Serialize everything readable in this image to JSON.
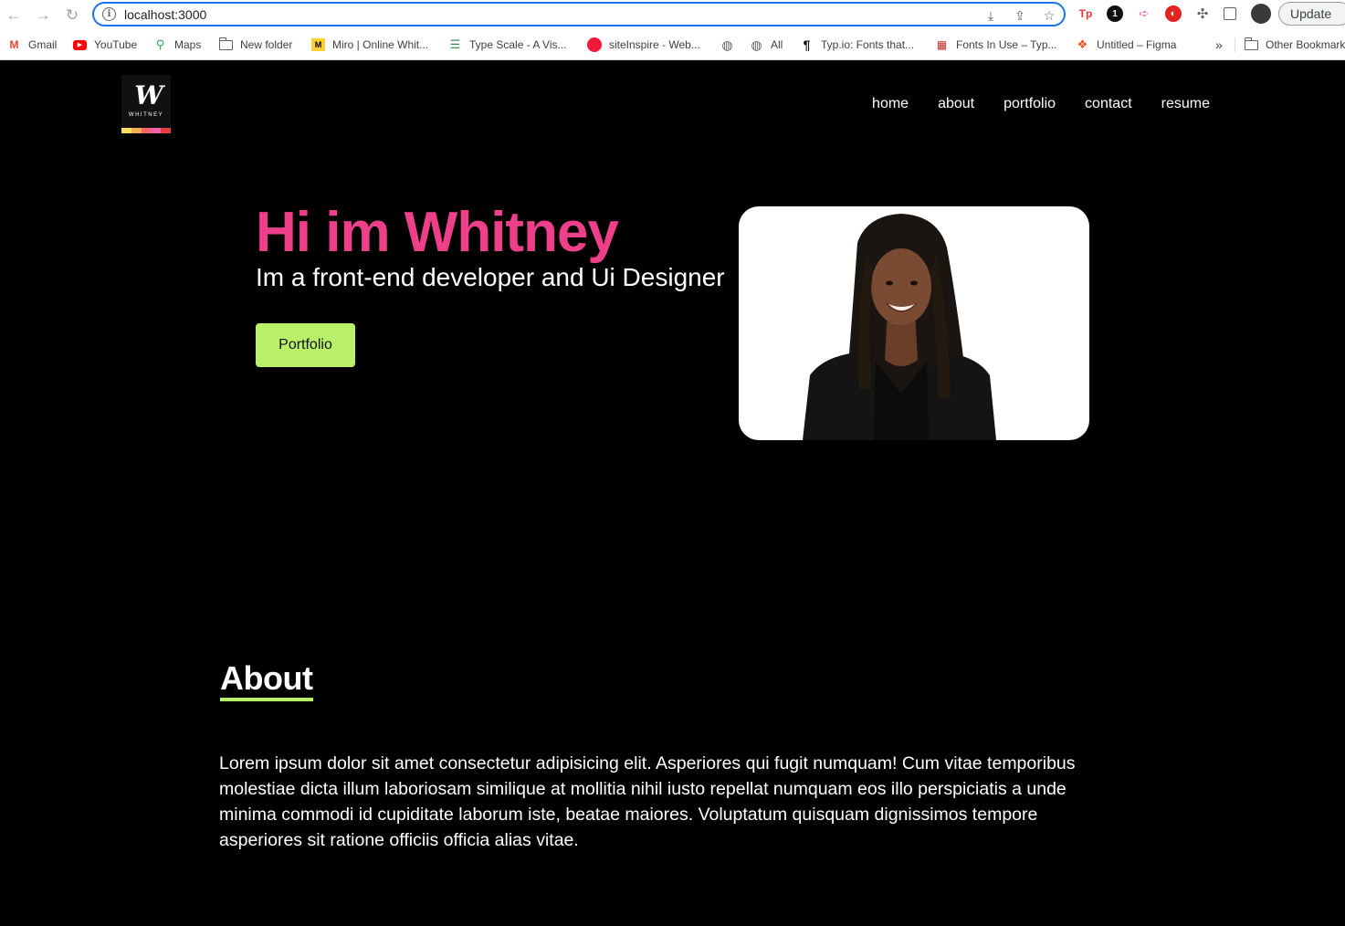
{
  "browser": {
    "url": "localhost:3000",
    "update_label": "Update",
    "bookmarks": [
      {
        "label": "Gmail",
        "icon": "gmail-icon"
      },
      {
        "label": "YouTube",
        "icon": "youtube-icon"
      },
      {
        "label": "Maps",
        "icon": "maps-icon"
      },
      {
        "label": "New folder",
        "icon": "folder-icon"
      },
      {
        "label": "Miro | Online Whit...",
        "icon": "miro-icon"
      },
      {
        "label": "Type Scale - A Vis...",
        "icon": "typescale-icon"
      },
      {
        "label": "siteInspire - Web...",
        "icon": "siteinspire-icon"
      },
      {
        "label": "",
        "icon": "globe-icon"
      },
      {
        "label": "All",
        "icon": "globe-icon"
      },
      {
        "label": "Typ.io: Fonts that...",
        "icon": "typio-icon"
      },
      {
        "label": "Fonts In Use – Typ...",
        "icon": "fontsinuse-icon"
      },
      {
        "label": "Untitled – Figma",
        "icon": "figma-icon"
      },
      {
        "label": "»",
        "icon": "overflow-icon"
      },
      {
        "label": "Other Bookmarks",
        "icon": "folder-icon"
      }
    ]
  },
  "site": {
    "logo_word": "WHITNEY",
    "nav": [
      "home",
      "about",
      "portfolio",
      "contact",
      "resume"
    ],
    "hero": {
      "title": "Hi im Whitney",
      "subtitle": "Im a front-end developer and Ui Designer",
      "button": "Portfolio"
    },
    "about": {
      "heading": "About",
      "body": "Lorem ipsum dolor sit amet consectetur adipisicing elit. Asperiores qui fugit numquam! Cum vitae temporibus molestiae dicta illum laboriosam similique at mollitia nihil iusto repellat numquam eos illo perspiciatis a unde minima commodi id cupiditate laborum iste, beatae maiores. Voluptatum quisquam dignissimos tempore asperiores sit ratione officiis officia alias vitae."
    }
  },
  "colors": {
    "accent_pink": "#ee3f8b",
    "accent_green": "#b9f06a",
    "background": "#000000"
  }
}
